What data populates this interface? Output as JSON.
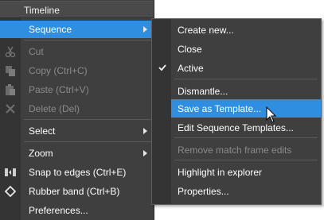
{
  "timeline_menu": {
    "title": "Timeline",
    "items": [
      {
        "label": "Sequence",
        "submenu": true,
        "highlighted": true
      },
      {
        "label": "Cut",
        "disabled": true,
        "icon": "scissors-icon"
      },
      {
        "label": "Copy (Ctrl+C)",
        "disabled": true,
        "icon": "copy-icon"
      },
      {
        "label": "Paste (Ctrl+V)",
        "disabled": true,
        "icon": "paste-icon"
      },
      {
        "label": "Delete (Del)",
        "disabled": true,
        "icon": "delete-icon"
      },
      {
        "label": "Select",
        "submenu": true
      },
      {
        "label": "Zoom",
        "submenu": true
      },
      {
        "label": "Snap to edges (Ctrl+E)",
        "icon": "snap-icon"
      },
      {
        "label": "Rubber band (Ctrl+B)",
        "icon": "rubber-band-icon"
      },
      {
        "label": "Preferences..."
      }
    ]
  },
  "sequence_submenu": {
    "items": [
      {
        "label": "Create new..."
      },
      {
        "label": "Close"
      },
      {
        "label": "Active",
        "checked": true
      },
      {
        "label": "Dismantle..."
      },
      {
        "label": "Save as Template...",
        "highlighted": true
      },
      {
        "label": "Edit Sequence Templates..."
      },
      {
        "label": "Remove match frame edits",
        "disabled": true
      },
      {
        "label": "Highlight in explorer"
      },
      {
        "label": "Properties..."
      }
    ]
  },
  "colors": {
    "menu_bg": "#3f3f3f",
    "gutter_bg": "#343434",
    "highlight": "#2f8ee0",
    "disabled_text": "#8a8a8a"
  }
}
